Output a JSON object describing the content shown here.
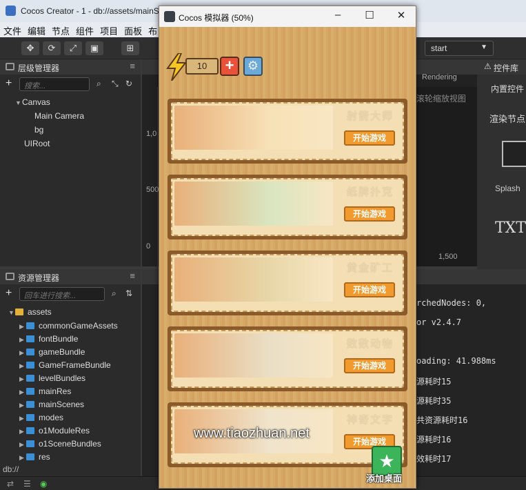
{
  "app": {
    "title": "Cocos Creator - 1 - db://assets/mainS",
    "brand_color": "#3a6fc2"
  },
  "menu": [
    "文件",
    "编辑",
    "节点",
    "组件",
    "项目",
    "面板",
    "布"
  ],
  "toolbar": {
    "start": "start"
  },
  "hierarchy": {
    "title": "层级管理器",
    "search_placeholder": "搜索...",
    "items": [
      "Canvas",
      "Main Camera",
      "bg",
      "UIRoot"
    ]
  },
  "assets": {
    "title": "资源管理器",
    "search_placeholder": "回车进行搜索...",
    "root": "assets",
    "folders": [
      "commonGameAssets",
      "fontBundle",
      "gameBundle",
      "GameFrameBundle",
      "levelBundles",
      "mainRes",
      "mainScenes",
      "modes",
      "o1ModuleRes",
      "o1SceneBundles",
      "res"
    ],
    "path": "db://"
  },
  "scene": {
    "rendering": "Rendering",
    "hint": "滚轮缩放视图",
    "y_labels": [
      "1,0",
      "500",
      "0"
    ],
    "x_label": "1,500"
  },
  "widget": {
    "title": "控件库",
    "builtin": "内置控件",
    "render_node": "渲染节点",
    "splash": "Splash",
    "txt": "TXT"
  },
  "console": {
    "lines": [
      "rchedNodes: 0,",
      "or v2.4.7",
      "",
      "oading: 41.988ms",
      "源耗时15",
      "源耗时35",
      "共资源耗时16",
      "源耗时16",
      "效耗时17"
    ]
  },
  "simulator": {
    "title": "Cocos 模拟器 (50%)",
    "energy": "10",
    "cards": [
      {
        "name": "射箭大师",
        "button": "开始游戏",
        "color": "#f8e6c4",
        "art": "#f7e1b6"
      },
      {
        "name": "纸牌扑克",
        "button": "开始游戏",
        "color": "#f8e6c4",
        "art": "#d9e6c0"
      },
      {
        "name": "黄金矿工",
        "button": "开始游戏",
        "color": "#f8e6c4",
        "art": "#e7d7a8"
      },
      {
        "name": "数数动物",
        "button": "开始游戏",
        "color": "#f8e6c4",
        "art": "#e9dfc6"
      },
      {
        "name": "神奇文字",
        "button": "开始游戏",
        "color": "#f8e6c4",
        "art": "#efe4cc"
      }
    ],
    "add_home": "添加桌面",
    "watermark": "www.tiaozhuan.net"
  }
}
